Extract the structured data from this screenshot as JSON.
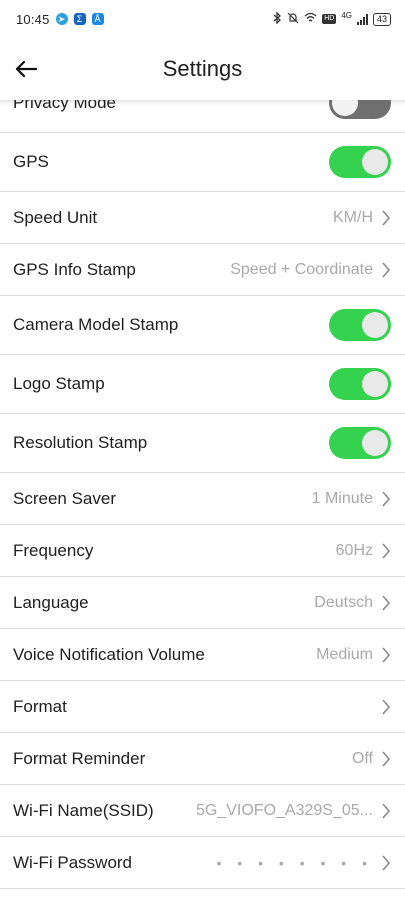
{
  "status_bar": {
    "time": "10:45",
    "network": "4G",
    "battery": "43"
  },
  "header": {
    "title": "Settings"
  },
  "settings": [
    {
      "label": "Privacy Mode",
      "type": "toggle",
      "state": "off"
    },
    {
      "label": "GPS",
      "type": "toggle",
      "state": "on"
    },
    {
      "label": "Speed Unit",
      "type": "nav",
      "value": "KM/H"
    },
    {
      "label": "GPS Info Stamp",
      "type": "nav",
      "value": "Speed + Coordinate"
    },
    {
      "label": "Camera Model Stamp",
      "type": "toggle",
      "state": "on"
    },
    {
      "label": "Logo Stamp",
      "type": "toggle",
      "state": "on"
    },
    {
      "label": "Resolution Stamp",
      "type": "toggle",
      "state": "on"
    },
    {
      "label": "Screen Saver",
      "type": "nav",
      "value": "1 Minute"
    },
    {
      "label": "Frequency",
      "type": "nav",
      "value": "60Hz"
    },
    {
      "label": "Language",
      "type": "nav",
      "value": "Deutsch"
    },
    {
      "label": "Voice Notification Volume",
      "type": "nav",
      "value": "Medium"
    },
    {
      "label": "Format",
      "type": "nav",
      "value": ""
    },
    {
      "label": "Format Reminder",
      "type": "nav",
      "value": "Off"
    },
    {
      "label": "Wi-Fi Name(SSID)",
      "type": "nav",
      "value": "5G_VIOFO_A329S_05..."
    },
    {
      "label": "Wi-Fi Password",
      "type": "nav",
      "value": "• • • • • • • •"
    }
  ],
  "colors": {
    "toggle_on": "#34d24e",
    "toggle_off": "#6f6f6f",
    "value_text": "#a9a9a9"
  }
}
